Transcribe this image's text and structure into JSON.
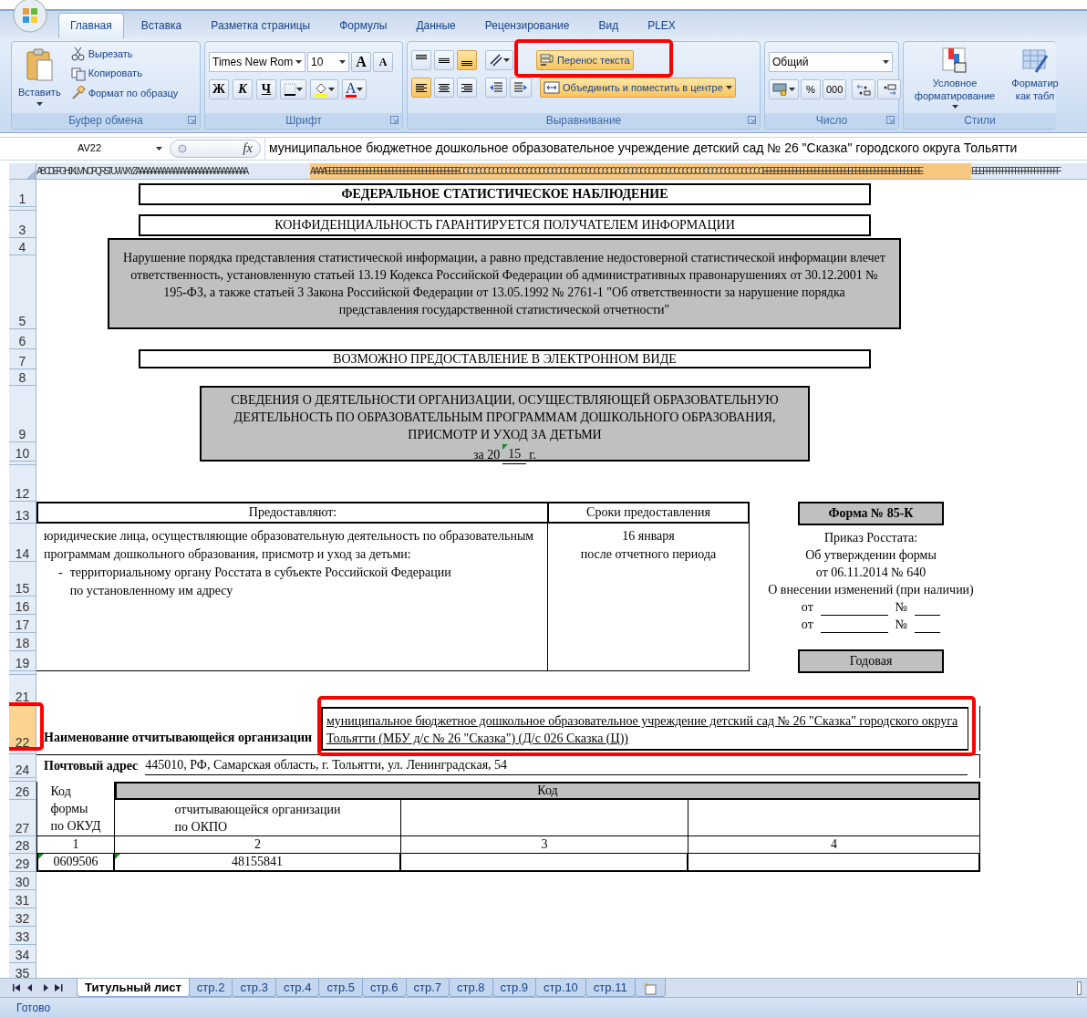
{
  "ribbon_tabs": [
    {
      "label": "Главная",
      "selected": true
    },
    {
      "label": "Вставка",
      "selected": false
    },
    {
      "label": "Разметка страницы",
      "selected": false
    },
    {
      "label": "Формулы",
      "selected": false
    },
    {
      "label": "Данные",
      "selected": false
    },
    {
      "label": "Рецензирование",
      "selected": false
    },
    {
      "label": "Вид",
      "selected": false
    },
    {
      "label": "PLEX",
      "selected": false
    }
  ],
  "clipboard": {
    "paste": "Вставить",
    "items": [
      "Вырезать",
      "Копировать",
      "Формат по образцу"
    ],
    "label": "Буфер обмена"
  },
  "font": {
    "name": "Times New Rom",
    "size": "10",
    "grow": "A",
    "shrink": "A",
    "bold": "Ж",
    "italic": "К",
    "underline": "Ч",
    "color_letter": "A",
    "label": "Шрифт"
  },
  "alignment": {
    "vertical": [
      {
        "selected": false
      },
      {
        "selected": false
      },
      {
        "selected": true
      }
    ],
    "horizontal": [
      {
        "selected": true
      },
      {
        "selected": false
      },
      {
        "selected": false
      }
    ],
    "wrap": {
      "label": "Перенос текста",
      "active": true,
      "annotated": true
    },
    "merge": {
      "label": "Объединить и поместить в центре",
      "active": true
    },
    "label": "Выравнивание"
  },
  "number": {
    "format": "Общий",
    "percent": "%",
    "thousands": "000",
    "label": "Число"
  },
  "styles": {
    "conditional": "Условное форматирование",
    "table": "Форматир как табл",
    "label": "Стили"
  },
  "formula_bar": {
    "name_box": "AV22",
    "fx": "fx",
    "formula": "муниципальное бюджетное дошкольное образовательное учреждение детский сад № 26 \"Сказка\" городского округа Тольятти"
  },
  "column_header": {
    "before": "ABCDEFGHIJKLMNOPQRSTUVWXYZAAAAAAAAAAAAAAAAAAAAAAAAAAAAAA",
    "selected": "AAAAEEEEEEEEEEEEEEEEEEEEEEEEEEEEEEEEEEEECCCCCCCCCCCCCCCCCCCCCCCCCCCCCCCCCCCCCCCCCCCCCCCCCCCCCCCCCCCCCCCCCCCCCCCCEEEEEEEEEEEEEEEEEEEEEEEEEEEEEEEEEEEEEEEEEEE",
    "after": "EEEFFFFFFFFFFFFFFFFFFFFFFFF"
  },
  "row_headers": [
    {
      "label": "1",
      "selected": false
    },
    {
      "label": "3",
      "selected": false
    },
    {
      "label": "4",
      "selected": false
    },
    {
      "label": "5",
      "selected": false
    },
    {
      "label": "6",
      "selected": false
    },
    {
      "label": "7",
      "selected": false
    },
    {
      "label": "8",
      "selected": false
    },
    {
      "label": "9",
      "selected": false
    },
    {
      "label": "10",
      "selected": false
    },
    {
      "label": "12",
      "selected": false
    },
    {
      "label": "13",
      "selected": false
    },
    {
      "label": "14",
      "selected": false
    },
    {
      "label": "15",
      "selected": false
    },
    {
      "label": "16",
      "selected": false
    },
    {
      "label": "17",
      "selected": false
    },
    {
      "label": "18",
      "selected": false
    },
    {
      "label": "19",
      "selected": false
    },
    {
      "label": "21",
      "selected": false
    },
    {
      "label": "22",
      "selected": true,
      "annotated": true
    },
    {
      "label": "24",
      "selected": false
    },
    {
      "label": "26",
      "selected": false
    },
    {
      "label": "27",
      "selected": false
    },
    {
      "label": "28",
      "selected": false
    },
    {
      "label": "29",
      "selected": false
    },
    {
      "label": "30",
      "selected": false
    },
    {
      "label": "31",
      "selected": false
    },
    {
      "label": "32",
      "selected": false
    },
    {
      "label": "33",
      "selected": false
    },
    {
      "label": "34",
      "selected": false
    },
    {
      "label": "35",
      "selected": false
    }
  ],
  "sheet": {
    "survey": "ФЕДЕРАЛЬНОЕ СТАТИСТИЧЕСКОЕ НАБЛЮДЕНИЕ",
    "confidential": "КОНФИДЕНЦИАЛЬНОСТЬ ГАРАНТИРУЕТСЯ ПОЛУЧАТЕЛЕМ ИНФОРМАЦИИ",
    "warning": "Нарушение порядка представления статистической информации, а равно представление недостоверной статистической информации влечет ответственность, установленную статьей 13.19 Кодекса Российской Федерации об административных правонарушениях от 30.12.2001 № 195-ФЗ, а также статьей 3 Закона Российской Федерации от 13.05.1992 № 2761-1 \"Об ответственности за нарушение порядка представления государственной статистической отчетности\"",
    "electronic": "ВОЗМОЖНО ПРЕДОСТАВЛЕНИЕ В ЭЛЕКТРОННОМ ВИДЕ",
    "title": "СВЕДЕНИЯ О ДЕЯТЕЛЬНОСТИ ОРГАНИЗАЦИИ, ОСУЩЕСТВЛЯЮЩЕЙ ОБРАЗОВАТЕЛЬНУЮ ДЕЯТЕЛЬНОСТЬ ПО ОБРАЗОВАТЕЛЬНЫМ ПРОГРАММАМ ДОШКОЛЬНОГО ОБРАЗОВАНИЯ, ПРИСМОТР И УХОД ЗА ДЕТЬМИ",
    "period": {
      "prefix": "за 20",
      "year": "15",
      "flagged": true,
      "suffix": "г."
    },
    "submitters": {
      "header": "Предоставляют:",
      "text": "юридические лица, осуществляющие образовательную деятельность по образовательным программам дошкольного образования, присмотр и уход за детьми:",
      "bullet": "-",
      "item": "территориальному органу Росстата в субъекте Российской Федерации по установленному им адресу"
    },
    "deadline": {
      "header": "Сроки предоставления",
      "lines": [
        "16 января",
        "после отчетного периода"
      ]
    },
    "form": {
      "number": "Форма № 85-К",
      "order_lines": [
        "Приказ Росстата:",
        "Об утверждении формы",
        "от 06.11.2014 № 640",
        "О внесении изменений (при наличии)"
      ],
      "amendments": [
        {
          "from": "от",
          "no": "№"
        },
        {
          "from": "от",
          "no": "№"
        }
      ],
      "period": "Годовая"
    },
    "organization": {
      "label": "Наименование отчитывающейся организации",
      "value": "муниципальное бюджетное дошкольное образовательное учреждение детский сад № 26 \"Сказка\" городского округа Тольятти (МБУ д/с № 26 \"Сказка\") (Д/с 026 Сказка (Ц))",
      "annotated": true
    },
    "address": {
      "label": "Почтовый адрес",
      "value": "445010, РФ, Самарская область, г. Тольятти, ул. Ленинградская, 54"
    },
    "codes": {
      "okud_header": [
        "Код",
        "формы",
        "по ОКУД"
      ],
      "code_header": "Код",
      "okpo_header": [
        "отчитывающейся организации",
        "по ОКПО"
      ],
      "numbers": [
        "1",
        "2",
        "3",
        "4"
      ],
      "values": [
        {
          "text": "0609506",
          "flagged": true
        },
        {
          "text": "48155841",
          "flagged": true
        }
      ]
    }
  },
  "sheet_tabs": [
    {
      "label": "Титульный лист",
      "selected": true
    },
    {
      "label": "стр.2",
      "selected": false
    },
    {
      "label": "стр.3",
      "selected": false
    },
    {
      "label": "стр.4",
      "selected": false
    },
    {
      "label": "стр.5",
      "selected": false
    },
    {
      "label": "стр.6",
      "selected": false
    },
    {
      "label": "стр.7",
      "selected": false
    },
    {
      "label": "стр.8",
      "selected": false
    },
    {
      "label": "стр.9",
      "selected": false
    },
    {
      "label": "стр.10",
      "selected": false
    },
    {
      "label": "стр.11",
      "selected": false
    }
  ],
  "status_bar": "Готово"
}
